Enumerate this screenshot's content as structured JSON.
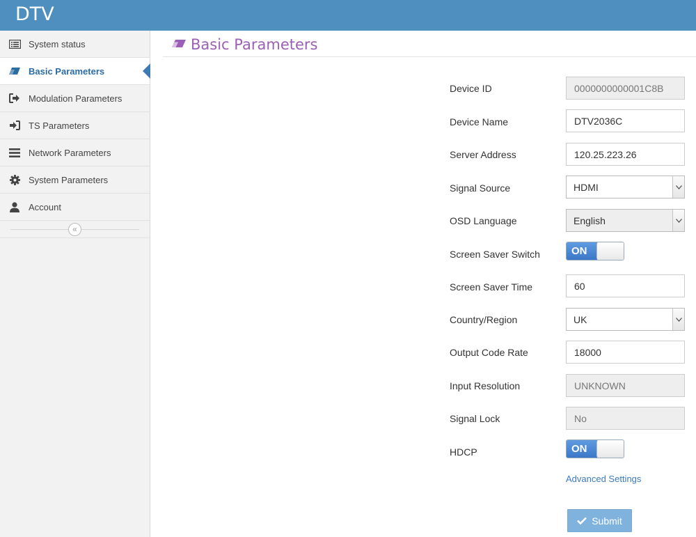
{
  "app": {
    "title": "DTV"
  },
  "sidebar": {
    "items": [
      {
        "label": "System status",
        "icon": "list-icon"
      },
      {
        "label": "Basic Parameters",
        "icon": "eraser-icon",
        "active": true
      },
      {
        "label": "Modulation Parameters",
        "icon": "sign-out-icon"
      },
      {
        "label": "TS Parameters",
        "icon": "sign-in-icon"
      },
      {
        "label": "Network Parameters",
        "icon": "bars-icon"
      },
      {
        "label": "System Parameters",
        "icon": "gear-icon"
      },
      {
        "label": "Account",
        "icon": "user-icon"
      }
    ],
    "collapse_glyph": "«"
  },
  "page": {
    "title": "Basic Parameters",
    "title_icon": "eraser-icon",
    "title_color": "#9c5fb5"
  },
  "form": {
    "device_id": {
      "label": "Device ID",
      "value": "0000000000001C8B"
    },
    "device_name": {
      "label": "Device Name",
      "value": "DTV2036C"
    },
    "server_address": {
      "label": "Server Address",
      "value": "120.25.223.26"
    },
    "signal_source": {
      "label": "Signal Source",
      "value": "HDMI"
    },
    "osd_language": {
      "label": "OSD Language",
      "value": "English"
    },
    "screen_saver_switch": {
      "label": "Screen Saver Switch",
      "value": "ON"
    },
    "screen_saver_time": {
      "label": "Screen Saver Time",
      "value": "60"
    },
    "country_region": {
      "label": "Country/Region",
      "value": "UK"
    },
    "output_code_rate": {
      "label": "Output Code Rate",
      "value": "18000"
    },
    "input_resolution": {
      "label": "Input Resolution",
      "value": "UNKNOWN"
    },
    "signal_lock": {
      "label": "Signal Lock",
      "value": "No"
    },
    "hdcp": {
      "label": "HDCP",
      "value": "ON"
    }
  },
  "advanced_link": "Advanced Settings",
  "submit_label": "Submit",
  "colors": {
    "header": "#4f8fc0",
    "accent": "#2b6ca3",
    "submit": "#7fb3dd"
  }
}
